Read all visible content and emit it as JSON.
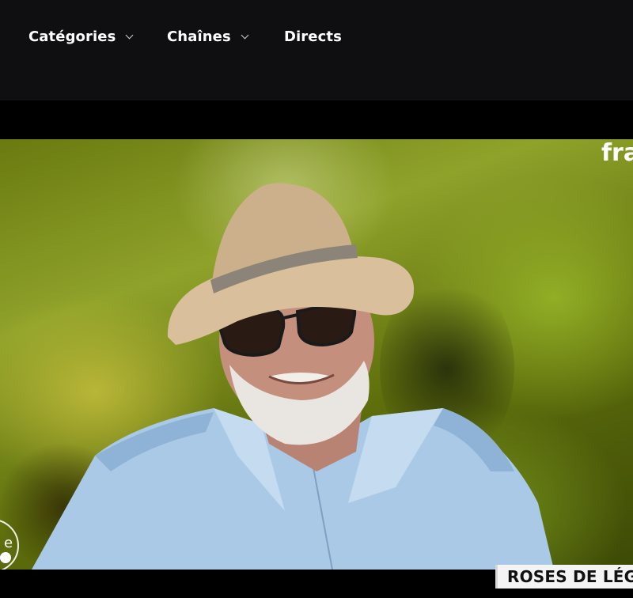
{
  "nav": {
    "categories_label": "Catégories",
    "chaines_label": "Chaînes",
    "directs_label": "Directs"
  },
  "player": {
    "channel_logo_text": "fra",
    "corner_badge_text": "e",
    "program_banner": "ROSES DE LÉG"
  },
  "colors": {
    "nav_background": "#0f0f12",
    "nav_text": "#ffffff",
    "banner_background": "#f4f4f4",
    "banner_text": "#111111"
  }
}
